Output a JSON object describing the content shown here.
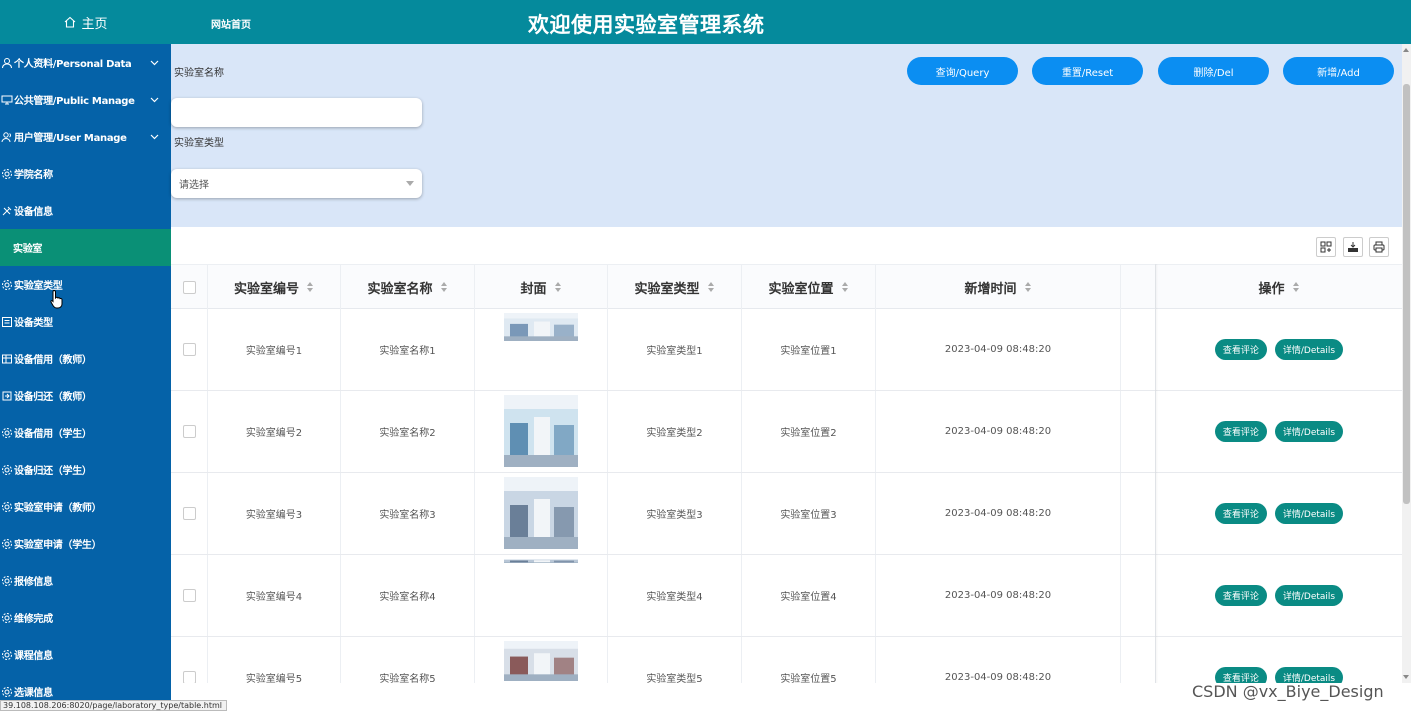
{
  "sidebar": {
    "home_label": "主页",
    "items": [
      {
        "label": "个人资料/Personal Data",
        "icon": "user-icon",
        "expandable": true
      },
      {
        "label": "公共管理/Public Manage",
        "icon": "monitor-icon",
        "expandable": true
      },
      {
        "label": "用户管理/User Manage",
        "icon": "users-icon",
        "expandable": true
      },
      {
        "label": "学院名称",
        "icon": "gear-icon",
        "expandable": false
      },
      {
        "label": "设备信息",
        "icon": "tools-icon",
        "expandable": false
      },
      {
        "label": "实验室",
        "icon": "",
        "expandable": false,
        "active": true
      },
      {
        "label": "实验室类型",
        "icon": "gear-icon",
        "expandable": false
      },
      {
        "label": "设备类型",
        "icon": "list-icon",
        "expandable": false
      },
      {
        "label": "设备借用（教师）",
        "icon": "grid-icon",
        "expandable": false
      },
      {
        "label": "设备归还（教师）",
        "icon": "return-icon",
        "expandable": false
      },
      {
        "label": "设备借用（学生）",
        "icon": "gear-icon",
        "expandable": false
      },
      {
        "label": "设备归还（学生）",
        "icon": "gear-icon",
        "expandable": false
      },
      {
        "label": "实验室申请（教师）",
        "icon": "gear-icon",
        "expandable": false
      },
      {
        "label": "实验室申请（学生）",
        "icon": "gear-icon",
        "expandable": false
      },
      {
        "label": "报修信息",
        "icon": "gear-icon",
        "expandable": false
      },
      {
        "label": "维修完成",
        "icon": "gear-icon",
        "expandable": false
      },
      {
        "label": "课程信息",
        "icon": "gear-icon",
        "expandable": false
      },
      {
        "label": "选课信息",
        "icon": "gear-icon",
        "expandable": false
      }
    ]
  },
  "header": {
    "home_link": "网站首页",
    "title": "欢迎使用实验室管理系统"
  },
  "search": {
    "name_label": "实验室名称",
    "name_value": "",
    "type_label": "实验室类型",
    "type_placeholder": "请选择",
    "buttons": {
      "query": "查询/Query",
      "reset": "重置/Reset",
      "delete": "删除/Del",
      "add": "新增/Add"
    }
  },
  "table": {
    "columns": [
      "实验室编号",
      "实验室名称",
      "封面",
      "实验室类型",
      "实验室位置",
      "新增时间",
      "操作"
    ],
    "rows": [
      {
        "code": "实验室编号1",
        "name": "实验室名称1",
        "type": "实验室类型1",
        "location": "实验室位置1",
        "time": "2023-04-09 08:48:20"
      },
      {
        "code": "实验室编号2",
        "name": "实验室名称2",
        "type": "实验室类型2",
        "location": "实验室位置2",
        "time": "2023-04-09 08:48:20"
      },
      {
        "code": "实验室编号3",
        "name": "实验室名称3",
        "type": "实验室类型3",
        "location": "实验室位置3",
        "time": "2023-04-09 08:48:20"
      },
      {
        "code": "实验室编号4",
        "name": "实验室名称4",
        "type": "实验室类型4",
        "location": "实验室位置4",
        "time": "2023-04-09 08:48:20"
      },
      {
        "code": "实验室编号5",
        "name": "实验室名称5",
        "type": "实验室类型5",
        "location": "实验室位置5",
        "time": "2023-04-09 08:48:20"
      }
    ],
    "actions": {
      "comments": "查看评论",
      "details": "详情/Details"
    }
  },
  "status_url": "39.108.108.206:8020/page/laboratory_type/table.html",
  "watermark": "CSDN @vx_Biye_Design",
  "colors": {
    "sidebar": "#0562a8",
    "header": "#058a9c",
    "active_item": "#0a9076",
    "search_bg": "#d9e6f8",
    "primary_button": "#0b8ef2",
    "action_button": "#0a8b84"
  }
}
